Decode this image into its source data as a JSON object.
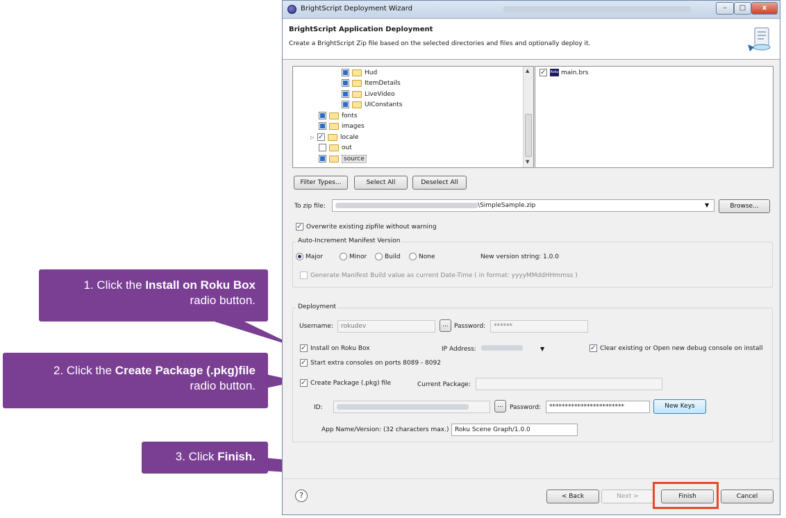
{
  "window": {
    "title": "BrightScript Deployment Wizard",
    "controls": {
      "minimize": "–",
      "maximize": "□",
      "close": "x"
    }
  },
  "header": {
    "title": "BrightScript Application Deployment",
    "description": "Create a BrightScript Zip file based on the selected directories and files and optionally deploy it."
  },
  "tree": {
    "items": [
      {
        "label": "Hud",
        "state": "partial"
      },
      {
        "label": "ItemDetails",
        "state": "partial"
      },
      {
        "label": "LiveVideo",
        "state": "partial"
      },
      {
        "label": "UIConstants",
        "state": "partial"
      },
      {
        "label": "fonts",
        "state": "partial"
      },
      {
        "label": "images",
        "state": "partial"
      },
      {
        "label": "locale",
        "state": "checked"
      },
      {
        "label": "out",
        "state": "unchecked"
      },
      {
        "label": "source",
        "state": "partial"
      }
    ]
  },
  "files": {
    "items": [
      {
        "label": "main.brs",
        "icon": "roku-icon",
        "state": "checked"
      }
    ],
    "roku_icon_text": "Roku"
  },
  "buttons": {
    "filter_types": "Filter Types...",
    "select_all": "Select All",
    "deselect_all": "Deselect All",
    "browse": "Browse...",
    "new_keys": "New Keys",
    "back": "< Back",
    "next": "Next >",
    "finish": "Finish",
    "cancel": "Cancel",
    "ellipsis": "...",
    "help": "?"
  },
  "zip": {
    "label": "To zip file:",
    "value_suffix": "\\SimpleSample.zip"
  },
  "overwrite": {
    "label": "Overwrite existing zipfile without warning",
    "checked": true
  },
  "manifest": {
    "group_title": "Auto-Increment Manifest Version",
    "options": [
      "Major",
      "Minor",
      "Build",
      "None"
    ],
    "selected": "Major",
    "new_version": "New version string: 1.0.0",
    "generate_build_label": "Generate Manifest Build value as current Date-Time ( in format: yyyyMMddHHmmss )"
  },
  "deployment": {
    "group_title": "Deployment",
    "username_label": "Username:",
    "username_value": "rokudev",
    "password_label": "Password:",
    "password_value": "******",
    "install_label": "Install on Roku Box",
    "ip_label": "IP Address:",
    "clear_console_label": "Clear existing or Open new debug console on install",
    "extra_consoles_label": "Start extra consoles on ports 8089 - 8092",
    "create_package_label": "Create Package (.pkg) file",
    "current_package_label": "Current Package:",
    "id_label": "ID:",
    "key_password_label": "Password:",
    "key_password_value": "************************",
    "app_name_label": "App Name/Version: (32 characters max.)",
    "app_name_value": "Roku Scene Graph/1.0.0"
  },
  "callouts": {
    "c1_prefix": "1. Click the ",
    "c1_bold": "Install on Roku Box",
    "c1_suffix": "radio button.",
    "c2_prefix": "2. Click the ",
    "c2_bold": "Create Package (.pkg)file",
    "c2_suffix": "radio button.",
    "c3_prefix": "3. Click ",
    "c3_bold": "Finish."
  },
  "colors": {
    "callout": "#7a3f93",
    "highlight": "#e24a2a",
    "titlebar": "#c5d5e8"
  }
}
